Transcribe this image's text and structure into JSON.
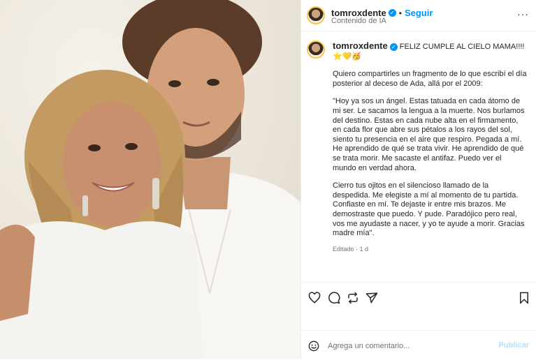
{
  "header": {
    "username": "tomroxdente",
    "follow_label": "Seguir",
    "subtitle": "Contenido de IA",
    "separator": "•",
    "more_label": "···"
  },
  "caption": {
    "username": "tomroxdente",
    "headline": "FELIZ CUMPLE AL CIELO MAMA!!!! ⭐💛🥳",
    "paragraphs": [
      "Quiero compartirles un fragmento de lo que escribí el día posterior al deceso de Ada, allá por el 2009:",
      "\"Hoy ya sos un ángel. Estas tatuada en cada átomo de mi ser. Le sacamos la lengua a la muerte. Nos burlamos del destino. Estas en cada nube alta en el firmamento, en cada flor que abre sus pétalos a los rayos del sol, siento tu presencia en el aire que respiro. Pegada a mí. He aprendido de qué se trata vivir. He aprendido de qué se trata morir. Me sacaste el antifaz. Puedo ver el mundo en verdad ahora.",
      "Cierro tus ojitos en el silencioso llamado de la despedida. Me elegiste a mí al momento de tu partida. Confiaste en mí. Te dejaste ir entre mis brazos. Me demostraste que puedo. Y pude. Paradójico pero real, vos me ayudaste a nacer, y yo te ayude a morir. Gracias madre mía\"."
    ],
    "edited": "Editado · 1 d"
  },
  "actions": {
    "like_icon": "heart-icon",
    "comment_icon": "comment-icon",
    "share_icon": "repost-icon",
    "send_icon": "send-icon",
    "save_icon": "bookmark-icon"
  },
  "comment": {
    "placeholder": "Agrega un comentario...",
    "publish_label": "Publicar"
  },
  "colors": {
    "accent": "#0095f6",
    "publish_disabled": "#b2dffc",
    "muted": "#737373"
  }
}
